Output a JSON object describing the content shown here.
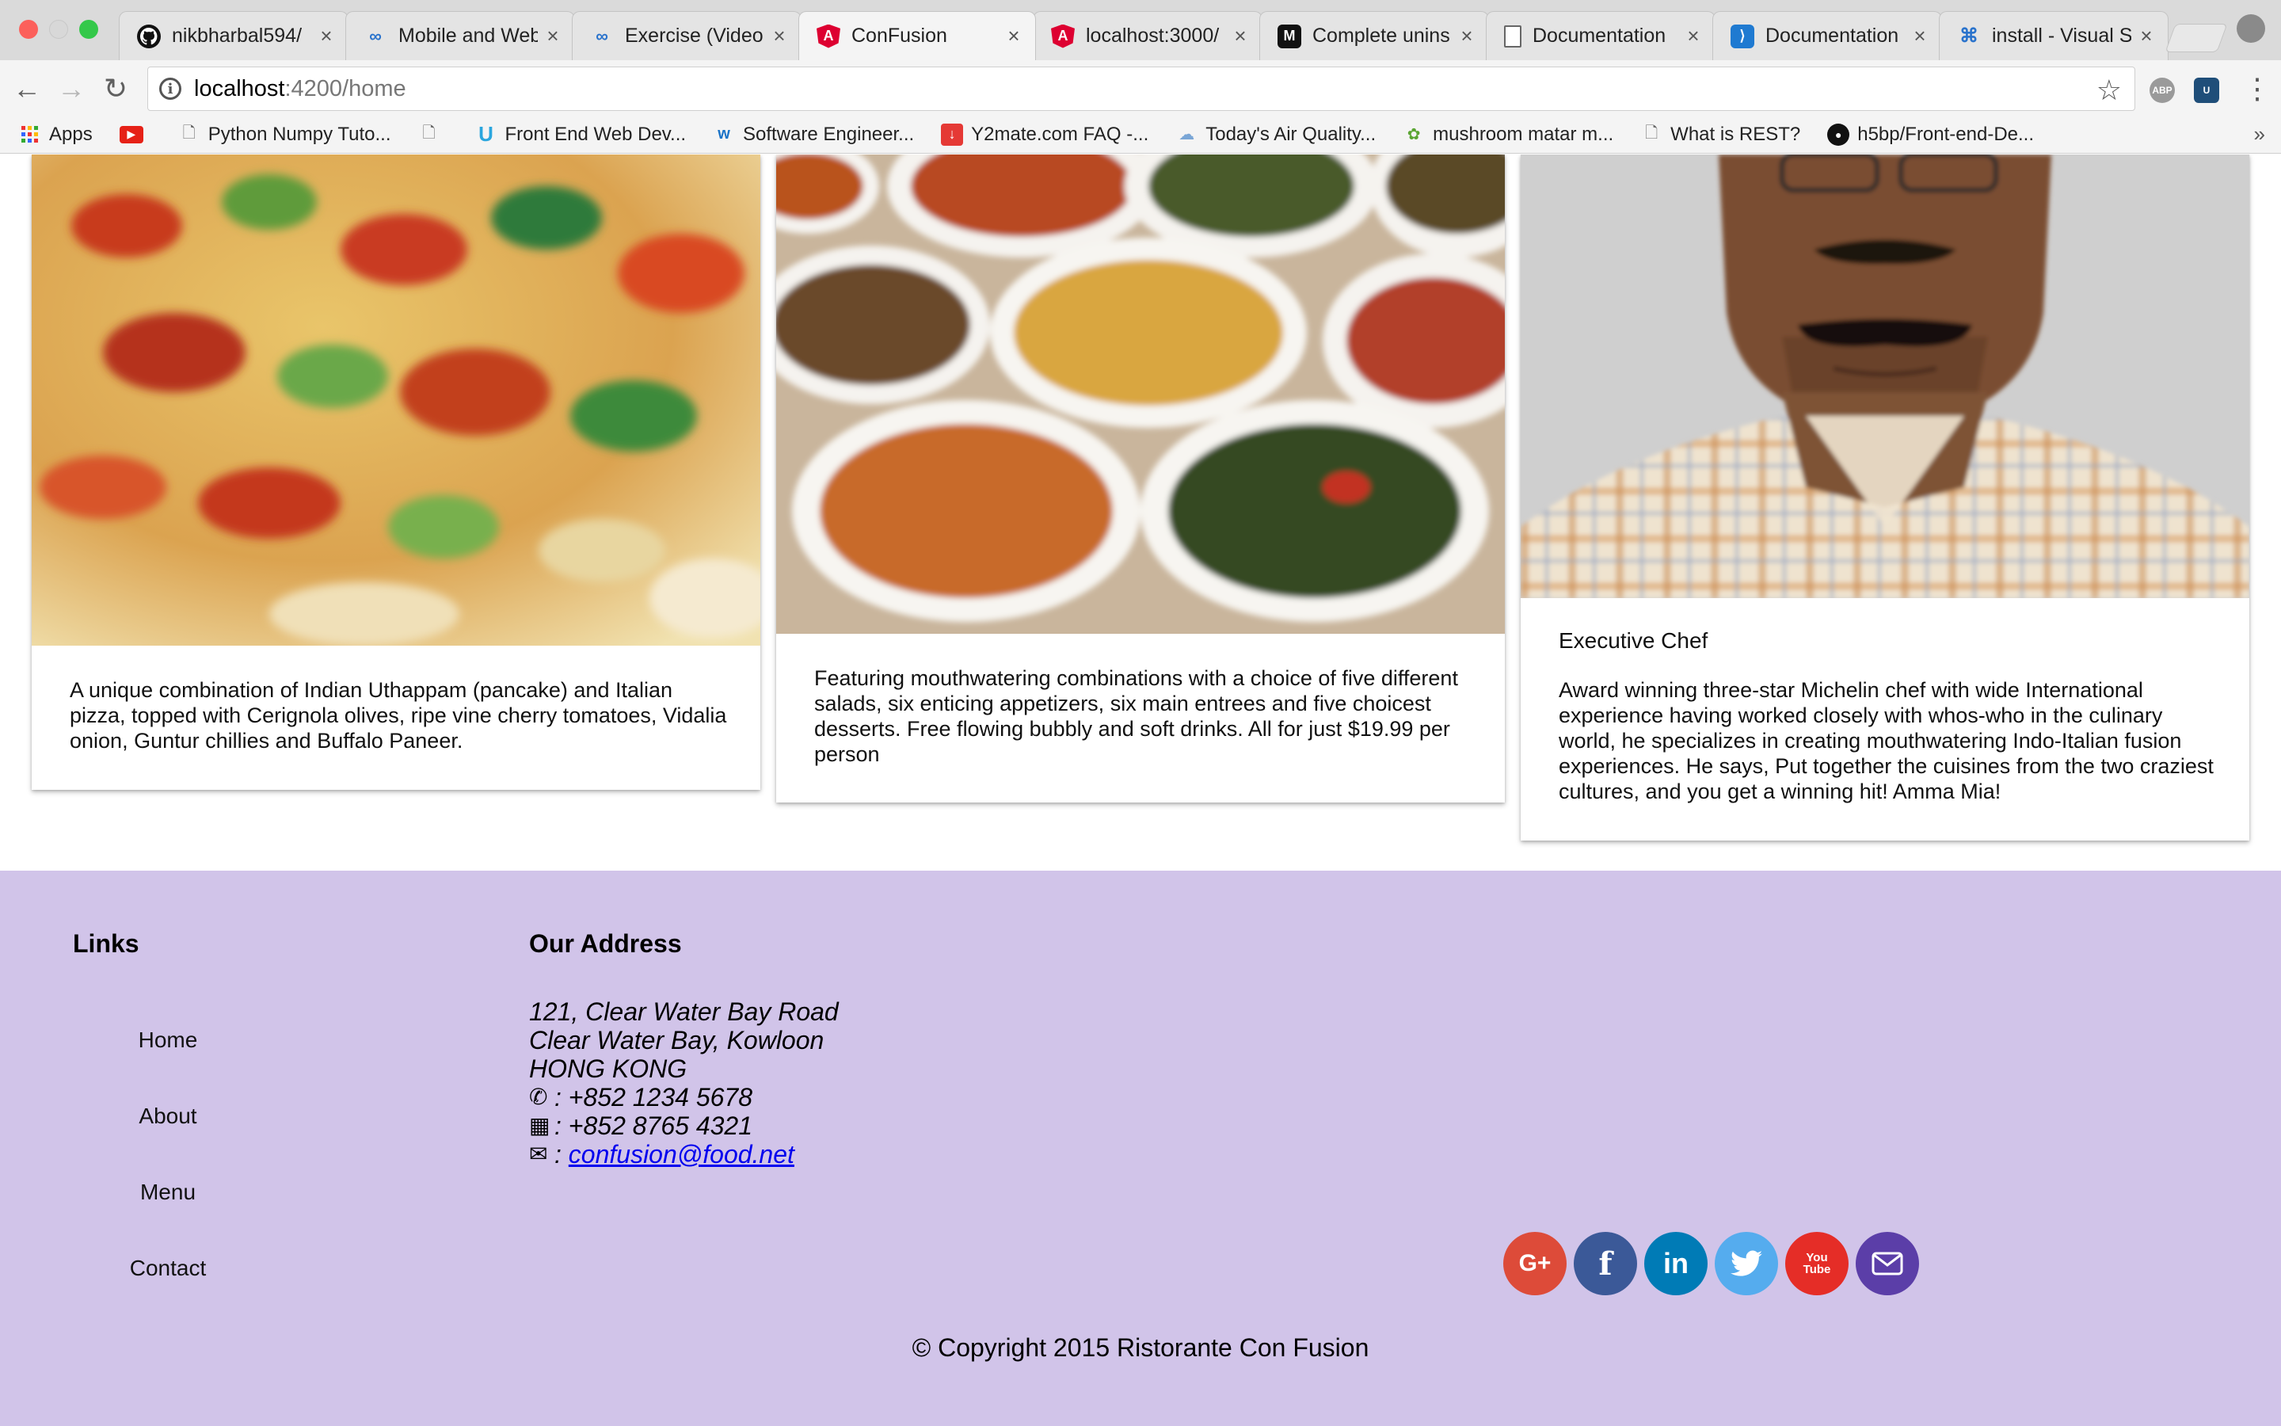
{
  "browser": {
    "tabs": [
      {
        "title": "nikbharbal594/",
        "icon": "github-icon"
      },
      {
        "title": "Mobile and Web",
        "icon": "coursera-icon"
      },
      {
        "title": "Exercise (Video",
        "icon": "coursera-icon"
      },
      {
        "title": "ConFusion",
        "icon": "angular-icon"
      },
      {
        "title": "localhost:3000/",
        "icon": "angular-icon"
      },
      {
        "title": "Complete unins",
        "icon": "medium-icon"
      },
      {
        "title": "Documentation",
        "icon": "document-icon"
      },
      {
        "title": "Documentation",
        "icon": "vscode-icon"
      },
      {
        "title": "install - Visual S",
        "icon": "command-icon"
      }
    ],
    "address": {
      "host": "localhost",
      "path": ":4200/home"
    },
    "bookmarks": [
      {
        "label": "Apps",
        "icon": "apps-grid-icon"
      },
      {
        "label": "",
        "icon": "youtube-icon"
      },
      {
        "label": "Python Numpy Tuto...",
        "icon": "document-icon"
      },
      {
        "label": "",
        "icon": "document-icon"
      },
      {
        "label": "Front End Web Dev...",
        "icon": "udemy-icon"
      },
      {
        "label": "Software Engineer...",
        "icon": "w-icon"
      },
      {
        "label": "Y2mate.com FAQ -...",
        "icon": "download-icon"
      },
      {
        "label": "Today's Air Quality...",
        "icon": "cloud-icon"
      },
      {
        "label": "mushroom matar m...",
        "icon": "leaf-icon"
      },
      {
        "label": "What is REST?",
        "icon": "document-icon"
      },
      {
        "label": "h5bp/Front-end-De...",
        "icon": "github-icon"
      }
    ]
  },
  "cards": [
    {
      "image": "pizza-image",
      "subtitle": "",
      "description": "A unique combination of Indian Uthappam (pancake) and Italian pizza, topped with Cerignola olives, ripe vine cherry tomatoes, Vidalia onion, Guntur chillies and Buffalo Paneer."
    },
    {
      "image": "buffet-image",
      "subtitle": "",
      "description": "Featuring mouthwatering combinations with a choice of five different salads, six enticing appetizers, six main entrees and five choicest desserts. Free flowing bubbly and soft drinks. All for just $19.99 per person"
    },
    {
      "image": "chef-image",
      "subtitle": "Executive Chef",
      "description": "Award winning three-star Michelin chef with wide International experience having worked closely with whos-who in the culinary world, he specializes in creating mouthwatering Indo-Italian fusion experiences. He says, Put together the cuisines from the two craziest cultures, and you get a winning hit! Amma Mia!"
    }
  ],
  "footer": {
    "links_heading": "Links",
    "links": [
      "Home",
      "About",
      "Menu",
      "Contact"
    ],
    "address_heading": "Our Address",
    "address_lines": [
      "121, Clear Water Bay Road",
      "Clear Water Bay, Kowloon",
      "HONG KONG"
    ],
    "phone": ": +852 1234 5678",
    "fax": ": +852 8765 4321",
    "email_prefix": ": ",
    "email": "confusion@food.net",
    "social": [
      {
        "name": "google-plus",
        "color": "#dd4b39",
        "glyph": "G+"
      },
      {
        "name": "facebook",
        "color": "#3b5998",
        "glyph": "f"
      },
      {
        "name": "linkedin",
        "color": "#007bb6",
        "glyph": "in"
      },
      {
        "name": "twitter",
        "color": "#55acee",
        "glyph": ""
      },
      {
        "name": "youtube",
        "color": "#e52d27",
        "glyph": "You Tube"
      },
      {
        "name": "mail",
        "color": "#5b3ea8",
        "glyph": ""
      }
    ],
    "copyright": "© Copyright 2015 Ristorante Con Fusion"
  },
  "colors": {
    "footer_bg": "#d1c4e9",
    "link": "#0000ee"
  }
}
